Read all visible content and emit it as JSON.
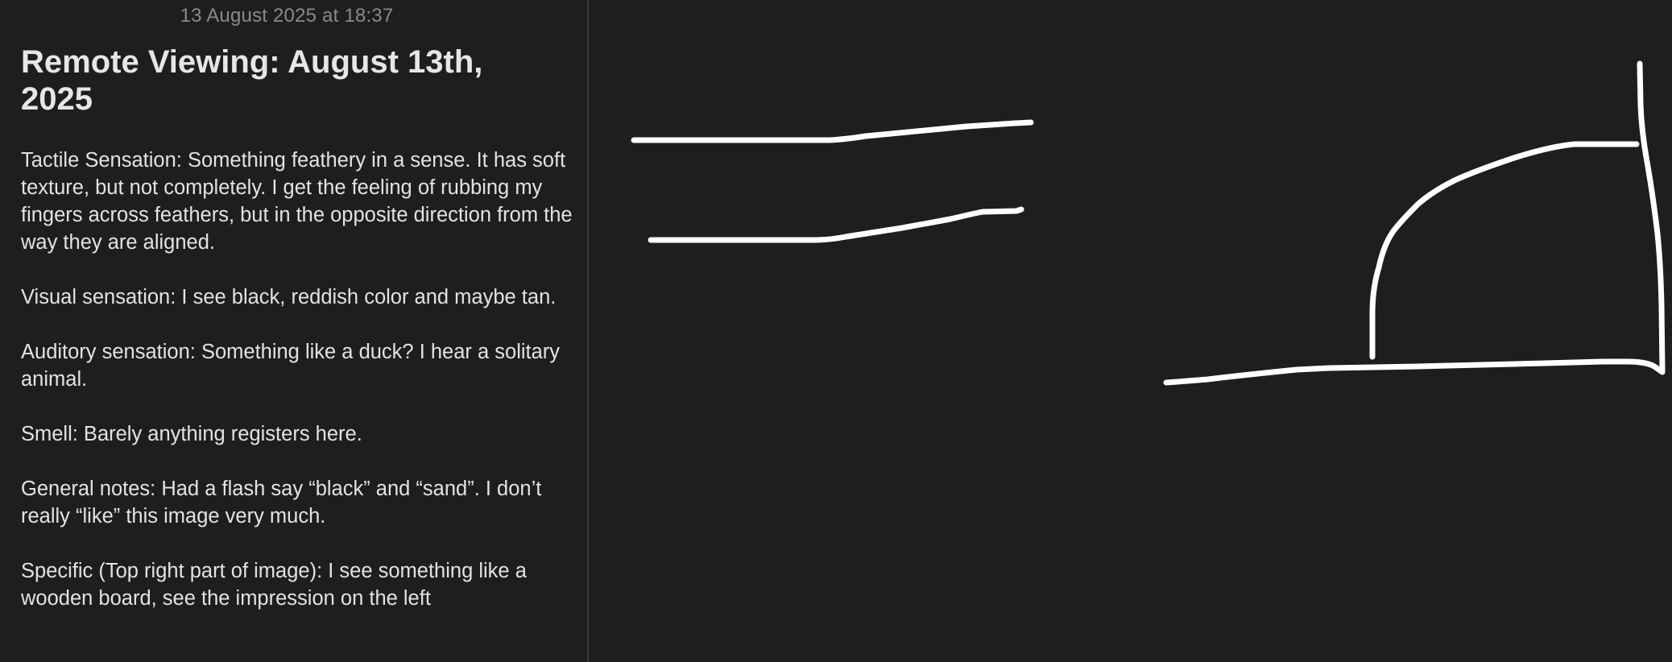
{
  "note": {
    "date": "13 August 2025 at 18:37",
    "title": "Remote Viewing: August 13th, 2025",
    "paragraphs": [
      "Tactile Sensation: Something feathery in a sense. It has soft texture, but not completely. I get the feeling of rubbing my fingers across feathers, but in the opposite direction from the way they are aligned.",
      "Visual sensation: I see black, reddish color and maybe tan.",
      "Auditory sensation: Something like a duck? I hear a solitary animal.",
      "Smell: Barely anything registers here.",
      "General notes: Had a flash say “black” and “sand”. I don’t really “like” this image very much.",
      "Specific (Top right part of image): I see something like a wooden board, see the impression on the left"
    ]
  },
  "colors": {
    "background": "#1e1e1e",
    "text": "#e3e3e3",
    "date_text": "#8a8a8a",
    "ink": "#ffffff"
  }
}
